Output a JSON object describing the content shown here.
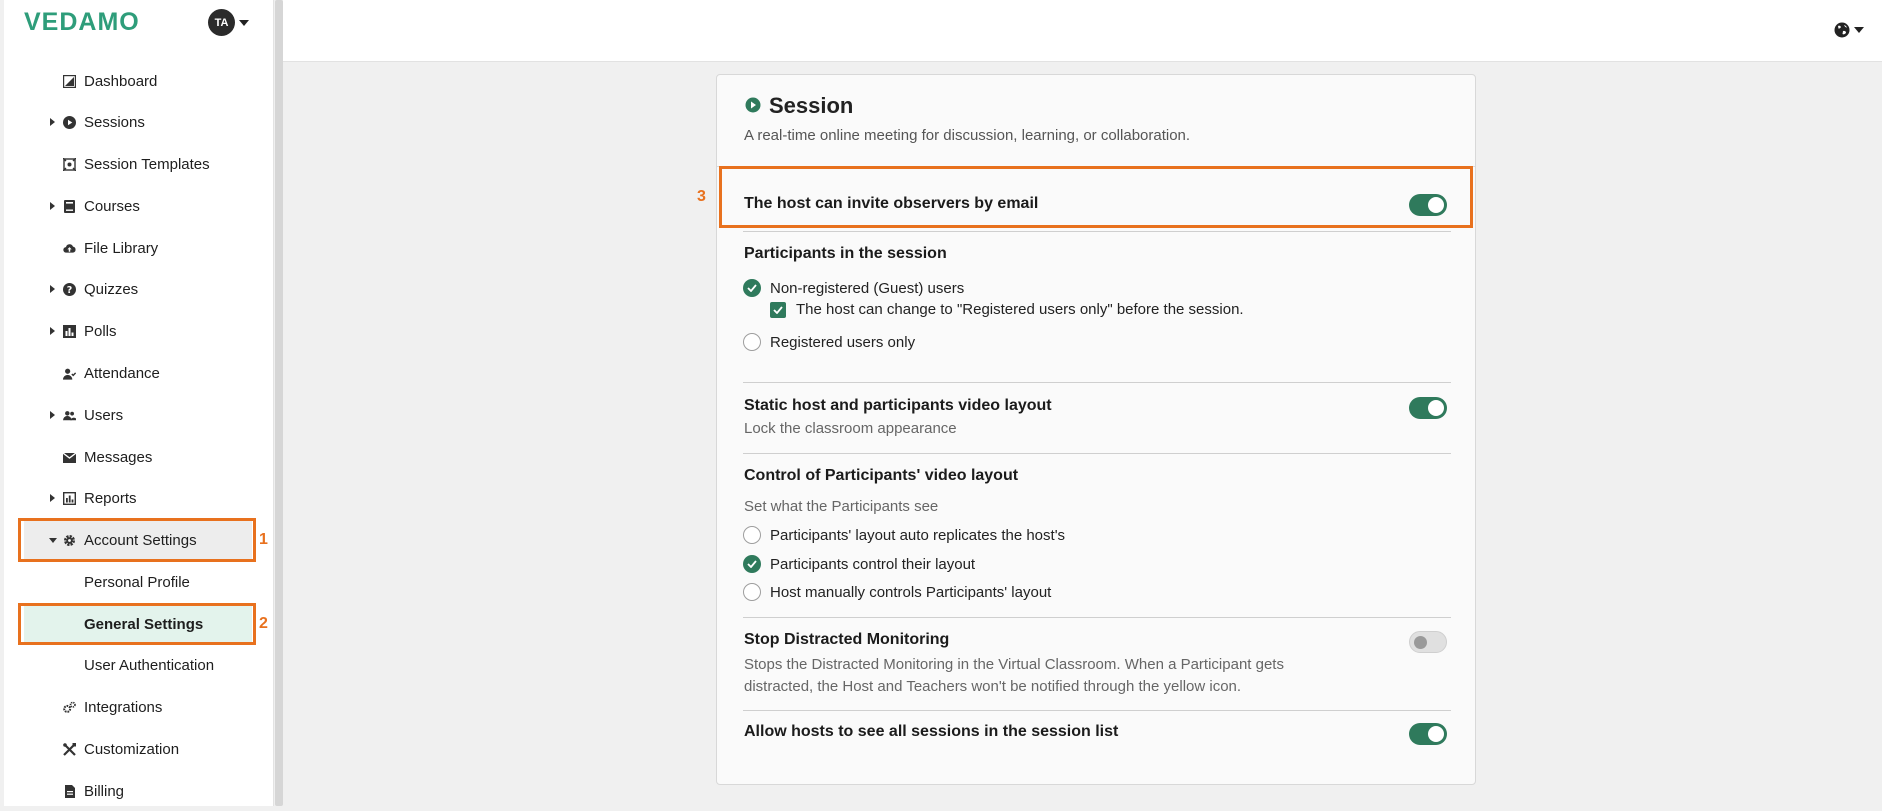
{
  "app": {
    "logo_text": "VEDAMO",
    "avatar_initials": "TA"
  },
  "sidebar": {
    "items": [
      {
        "label": "Dashboard",
        "icon": "dashboard-icon",
        "expandable": false
      },
      {
        "label": "Sessions",
        "icon": "play-circle-icon",
        "expandable": true
      },
      {
        "label": "Session Templates",
        "icon": "template-icon",
        "expandable": false
      },
      {
        "label": "Courses",
        "icon": "book-icon",
        "expandable": true
      },
      {
        "label": "File Library",
        "icon": "cloud-upload-icon",
        "expandable": false
      },
      {
        "label": "Quizzes",
        "icon": "question-circle-icon",
        "expandable": true
      },
      {
        "label": "Polls",
        "icon": "bar-chart-icon",
        "expandable": true
      },
      {
        "label": "Attendance",
        "icon": "user-check-icon",
        "expandable": false
      },
      {
        "label": "Users",
        "icon": "users-icon",
        "expandable": true
      },
      {
        "label": "Messages",
        "icon": "envelope-icon",
        "expandable": false
      },
      {
        "label": "Reports",
        "icon": "report-chart-icon",
        "expandable": true
      },
      {
        "label": "Account Settings",
        "icon": "gear-icon",
        "expandable": true,
        "expanded": true
      },
      {
        "label": "Personal Profile",
        "sub": true
      },
      {
        "label": "General Settings",
        "sub": true,
        "active": true
      },
      {
        "label": "User Authentication",
        "sub": true
      },
      {
        "label": "Integrations",
        "icon": "cogs-icon",
        "expandable": false
      },
      {
        "label": "Customization",
        "icon": "tools-icon",
        "expandable": false
      },
      {
        "label": "Billing",
        "icon": "invoice-icon",
        "expandable": false
      }
    ]
  },
  "annotations": {
    "n1": "1",
    "n2": "2",
    "n3": "3"
  },
  "card": {
    "title": "Session",
    "description": "A real-time online meeting for discussion, learning, or collaboration.",
    "invite_observers": {
      "label": "The host can invite observers by email",
      "enabled": true
    },
    "participants": {
      "title": "Participants in the session",
      "option_guests": "Non-registered (Guest) users",
      "option_guests_checked": true,
      "sub_checkbox": "The host can change to \"Registered users only\" before the session.",
      "sub_checkbox_checked": true,
      "option_registered": "Registered users only",
      "option_registered_checked": false
    },
    "static_layout": {
      "label": "Static host and participants video layout",
      "sub": "Lock the classroom appearance",
      "enabled": true
    },
    "control_layout": {
      "title": "Control of Participants' video layout",
      "sub": "Set what the Participants see",
      "options": [
        {
          "label": "Participants' layout auto replicates the host's",
          "checked": false
        },
        {
          "label": "Participants control their layout",
          "checked": true
        },
        {
          "label": "Host manually controls Participants' layout",
          "checked": false
        }
      ]
    },
    "distracted": {
      "label": "Stop Distracted Monitoring",
      "sub_line1": "Stops the Distracted Monitoring in the Virtual Classroom. When a Participant gets",
      "sub_line2": "distracted, the Host and Teachers won't be notified through the yellow icon.",
      "enabled": false
    },
    "see_all_sessions": {
      "label": "Allow hosts to see all sessions in the session list",
      "enabled": true
    }
  },
  "colors": {
    "brand": "#2e9d7a",
    "toggle_on": "#2f7a5c",
    "highlight": "#e8711e"
  }
}
